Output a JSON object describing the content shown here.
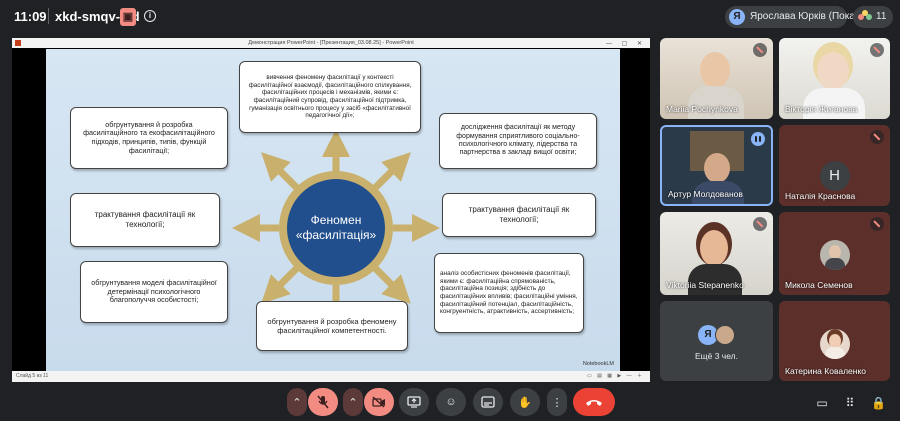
{
  "topbar": {
    "time": "11:09",
    "meeting_code": "xkd-smqv-fyd",
    "presenter_initial": "Я",
    "presenter_name": "Ярослава Юрків (Показ)",
    "participant_count": "11"
  },
  "powerpoint": {
    "window_title": "Демонстрация PowerPoint - [Презентация_03.08.25] - PowerPoint",
    "status_left": "Слайд 5 из 11",
    "brand": "NotebookLM"
  },
  "slide": {
    "center_title": "Феномен «фасилітація»",
    "boxes": {
      "top": "вивчення феномену фасилітації у контексті фасилітаційної взаємодії, фасилітаційного спілкування, фасилітаційних процесів і механізмів, якими є: фасилітаційний супровід, фасилітаційної підтримка, гуманізація освітнього процесу у засіб «фасилітативної педагогічної дії»;",
      "top_left": "обгрунтування й розробка фасилітаційного та екофасилітаційного підходів, принципів, типів, функцій фасилітації;",
      "top_right": "дослідження фасилітації як методу формування сприятливого соціально-психологічного клімату, лідерства та партнерства в закладі вищої освіти;",
      "left": "трактування фасилітації як технології;",
      "right": "трактування фасилітації як технології;",
      "bottom_left": "обгрунтування моделі фасилітаційної детермінації психологічного благополуччя особистості;",
      "bottom": "обгрунтування й розробка феномену фасилітаційної компетентності.",
      "bottom_right": "аналіз особистісних феноменів фасилітації, якими є: фасилітаційна спрямованість, фасилітаційна позиція; здібність до фасилітаційних впливів; фасилітаційні уміння, фасилітаційний потенціал, фасилітаційність, конгруентність, атрактивність, ассертивність;"
    }
  },
  "participants": [
    {
      "name": "Mariia Pochynkova"
    },
    {
      "name": "Вікторія Жиганова"
    },
    {
      "name": "Артур Молдованов"
    },
    {
      "name": "Наталія Краснова",
      "initial": "Н"
    },
    {
      "name": "Viktoriia Stepanenko"
    },
    {
      "name": "Микола Семенов"
    },
    {
      "name": "Ещё 3 чел.",
      "initial": "Я"
    },
    {
      "name": "Катерина Коваленко"
    }
  ],
  "colors": {
    "accent": "#8ab4f8",
    "end_call": "#ea4335",
    "mic_off": "#f28b82"
  }
}
